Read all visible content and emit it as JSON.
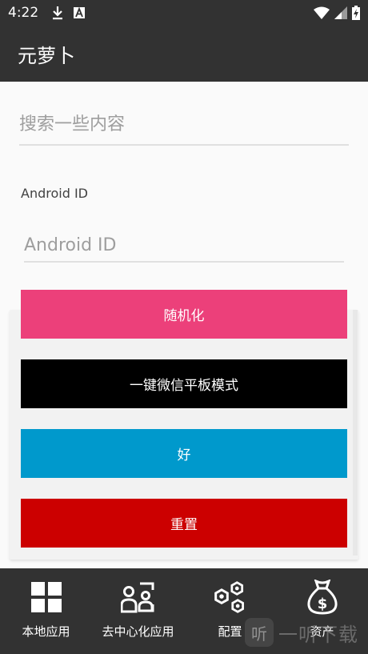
{
  "status_bar": {
    "time": "4:22",
    "icons": [
      "download-icon",
      "a-icon",
      "wifi-icon",
      "signal-icon",
      "battery-charging-icon"
    ]
  },
  "app_bar": {
    "title": "元萝卜"
  },
  "search": {
    "placeholder": "搜索一些内容",
    "value": ""
  },
  "android_id": {
    "label": "Android ID",
    "placeholder": "Android ID",
    "value": ""
  },
  "buttons": {
    "randomize": "随机化",
    "wechat_tablet": "一键微信平板模式",
    "ok": "好",
    "reset": "重置"
  },
  "colors": {
    "randomize": "#ec407a",
    "wechat_tablet": "#000000",
    "ok": "#0099cc",
    "reset": "#cc0000",
    "bars": "#323232"
  },
  "bottom_nav": {
    "items": [
      {
        "label": "本地应用",
        "icon": "grid-apps-icon"
      },
      {
        "label": "去中心化应用",
        "icon": "decentralized-users-icon"
      },
      {
        "label": "配置",
        "icon": "hexagon-nodes-icon"
      },
      {
        "label": "资产",
        "icon": "money-bag-icon"
      }
    ]
  },
  "watermark": {
    "text": "一听下载",
    "badge": "听"
  }
}
